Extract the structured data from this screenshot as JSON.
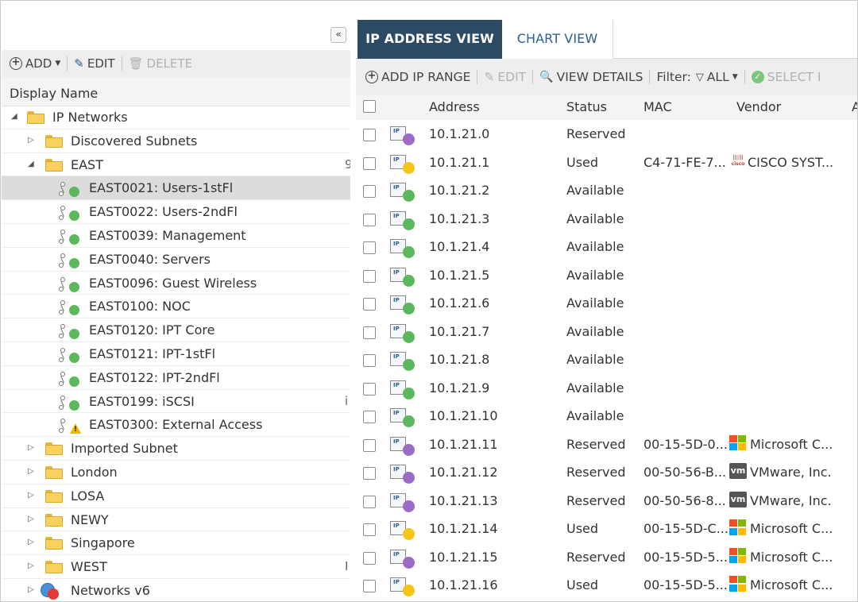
{
  "left_panel": {
    "collapse_glyph": "«",
    "toolbar": {
      "add_label": "ADD",
      "edit_label": "EDIT",
      "delete_label": "DELETE"
    },
    "column_header": "Display Name",
    "tree": [
      {
        "label": "IP Networks",
        "type": "folder",
        "level": 0,
        "expanded": true
      },
      {
        "label": "Discovered Subnets",
        "type": "folder",
        "level": 1,
        "expanded": false
      },
      {
        "label": "EAST",
        "type": "folder",
        "level": 1,
        "expanded": true,
        "cutoff": "9"
      },
      {
        "label": "EAST0021: Users-1stFl",
        "type": "subnet",
        "level": 2,
        "status": "up",
        "selected": true
      },
      {
        "label": "EAST0022: Users-2ndFl",
        "type": "subnet",
        "level": 2,
        "status": "up"
      },
      {
        "label": "EAST0039: Management",
        "type": "subnet",
        "level": 2,
        "status": "up"
      },
      {
        "label": "EAST0040: Servers",
        "type": "subnet",
        "level": 2,
        "status": "up"
      },
      {
        "label": "EAST0096: Guest Wireless",
        "type": "subnet",
        "level": 2,
        "status": "up"
      },
      {
        "label": "EAST0100: NOC",
        "type": "subnet",
        "level": 2,
        "status": "up"
      },
      {
        "label": "EAST0120: IPT Core",
        "type": "subnet",
        "level": 2,
        "status": "up"
      },
      {
        "label": "EAST0121: IPT-1stFl",
        "type": "subnet",
        "level": 2,
        "status": "up"
      },
      {
        "label": "EAST0122: IPT-2ndFl",
        "type": "subnet",
        "level": 2,
        "status": "up"
      },
      {
        "label": "EAST0199: iSCSI",
        "type": "subnet",
        "level": 2,
        "status": "up",
        "cutoff": "i"
      },
      {
        "label": "EAST0300: External Access",
        "type": "subnet",
        "level": 2,
        "status": "warning"
      },
      {
        "label": "Imported Subnet",
        "type": "folder",
        "level": 1,
        "expanded": false
      },
      {
        "label": "London",
        "type": "folder",
        "level": 1,
        "expanded": false
      },
      {
        "label": "LOSA",
        "type": "folder",
        "level": 1,
        "expanded": false
      },
      {
        "label": "NEWY",
        "type": "folder",
        "level": 1,
        "expanded": false
      },
      {
        "label": "Singapore",
        "type": "folder",
        "level": 1,
        "expanded": false
      },
      {
        "label": "WEST",
        "type": "folder",
        "level": 1,
        "expanded": false,
        "cutoff": "I"
      },
      {
        "label": "Networks v6",
        "type": "globe",
        "level": 1,
        "expanded": false
      }
    ]
  },
  "right_panel": {
    "tabs": {
      "ip_address_view": "IP ADDRESS VIEW",
      "chart_view": "CHART VIEW"
    },
    "toolbar": {
      "add_ip_range": "ADD IP RANGE",
      "edit": "EDIT",
      "view_details": "VIEW DETAILS",
      "filter_label": "Filter:",
      "filter_value": "ALL",
      "select": "SELECT I"
    },
    "columns": {
      "address": "Address",
      "status": "Status",
      "mac": "MAC",
      "vendor": "Vendor",
      "extra": "A"
    },
    "ip_icon_text": "IP",
    "rows": [
      {
        "address": "10.1.21.0",
        "status": "Reserved",
        "mac": "",
        "vendor": "",
        "logo": ""
      },
      {
        "address": "10.1.21.1",
        "status": "Used",
        "mac": "C4-71-FE-7...",
        "vendor": "CISCO SYST...",
        "logo": "cisco"
      },
      {
        "address": "10.1.21.2",
        "status": "Available",
        "mac": "",
        "vendor": "",
        "logo": ""
      },
      {
        "address": "10.1.21.3",
        "status": "Available",
        "mac": "",
        "vendor": "",
        "logo": ""
      },
      {
        "address": "10.1.21.4",
        "status": "Available",
        "mac": "",
        "vendor": "",
        "logo": ""
      },
      {
        "address": "10.1.21.5",
        "status": "Available",
        "mac": "",
        "vendor": "",
        "logo": ""
      },
      {
        "address": "10.1.21.6",
        "status": "Available",
        "mac": "",
        "vendor": "",
        "logo": ""
      },
      {
        "address": "10.1.21.7",
        "status": "Available",
        "mac": "",
        "vendor": "",
        "logo": ""
      },
      {
        "address": "10.1.21.8",
        "status": "Available",
        "mac": "",
        "vendor": "",
        "logo": ""
      },
      {
        "address": "10.1.21.9",
        "status": "Available",
        "mac": "",
        "vendor": "",
        "logo": ""
      },
      {
        "address": "10.1.21.10",
        "status": "Available",
        "mac": "",
        "vendor": "",
        "logo": ""
      },
      {
        "address": "10.1.21.11",
        "status": "Reserved",
        "mac": "00-15-5D-0...",
        "vendor": "Microsoft C...",
        "logo": "microsoft"
      },
      {
        "address": "10.1.21.12",
        "status": "Reserved",
        "mac": "00-50-56-B...",
        "vendor": "VMware, Inc.",
        "logo": "vmware"
      },
      {
        "address": "10.1.21.13",
        "status": "Reserved",
        "mac": "00-50-56-8...",
        "vendor": "VMware, Inc.",
        "logo": "vmware"
      },
      {
        "address": "10.1.21.14",
        "status": "Used",
        "mac": "00-15-5D-C...",
        "vendor": "Microsoft C...",
        "logo": "microsoft"
      },
      {
        "address": "10.1.21.15",
        "status": "Reserved",
        "mac": "00-15-5D-5...",
        "vendor": "Microsoft C...",
        "logo": "microsoft"
      },
      {
        "address": "10.1.21.16",
        "status": "Used",
        "mac": "00-15-5D-5...",
        "vendor": "Microsoft C...",
        "logo": "microsoft"
      }
    ]
  },
  "colors": {
    "tab_active_bg": "#2c4a64",
    "status_available": "#5cb85c",
    "status_used": "#f5c518",
    "status_reserved": "#9b6bc6",
    "warning": "#f5b400",
    "ms_red": "#f25022",
    "ms_green": "#7fba00",
    "ms_blue": "#00a4ef",
    "ms_yellow": "#ffb900"
  },
  "icons": {
    "collapse": "double-chevron-left-icon",
    "add": "circle-plus-icon",
    "edit": "pencil-icon",
    "delete": "trash-icon",
    "view_details": "document-search-icon",
    "filter": "funnel-icon",
    "select": "check-circle-icon",
    "folder": "folder-icon",
    "subnet": "network-icon",
    "ip": "ip-address-icon"
  }
}
